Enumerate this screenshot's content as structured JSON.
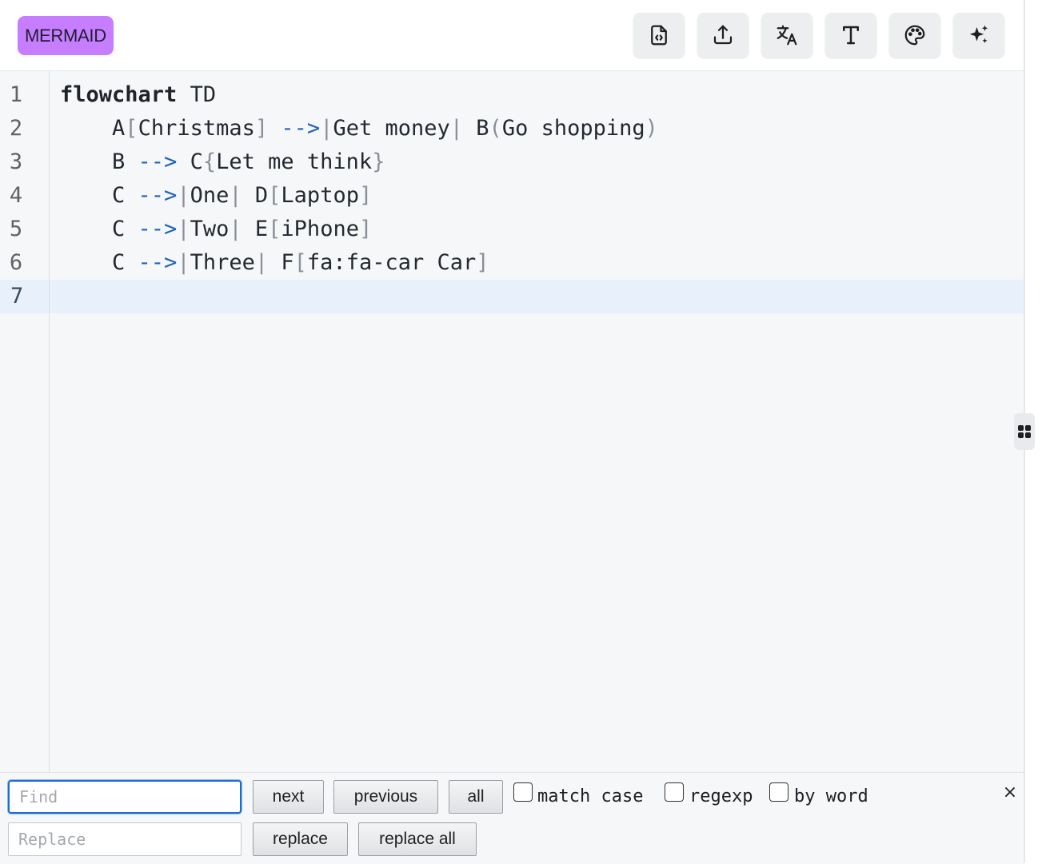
{
  "toolbar": {
    "badge": "MERMAID",
    "buttons": [
      {
        "name": "file-code-icon"
      },
      {
        "name": "share-upload-icon"
      },
      {
        "name": "translate-icon"
      },
      {
        "name": "font-type-icon"
      },
      {
        "name": "palette-icon"
      },
      {
        "name": "sparkles-icon"
      }
    ]
  },
  "editor": {
    "line_numbers": [
      "1",
      "2",
      "3",
      "4",
      "5",
      "6",
      "7"
    ],
    "active_line": 7,
    "lines": [
      {
        "indent": "",
        "tokens": [
          [
            "kw",
            "flowchart"
          ],
          [
            "t",
            " TD"
          ]
        ]
      },
      {
        "indent": "    ",
        "tokens": [
          [
            "t",
            "A"
          ],
          [
            "br",
            "["
          ],
          [
            "t",
            "Christmas"
          ],
          [
            "br",
            "]"
          ],
          [
            "t",
            " "
          ],
          [
            "arrow",
            "-->"
          ],
          [
            "br",
            "|"
          ],
          [
            "t",
            "Get money"
          ],
          [
            "br",
            "|"
          ],
          [
            "t",
            " B"
          ],
          [
            "br",
            "("
          ],
          [
            "t",
            "Go shopping"
          ],
          [
            "br",
            ")"
          ]
        ]
      },
      {
        "indent": "    ",
        "tokens": [
          [
            "t",
            "B "
          ],
          [
            "arrow",
            "-->"
          ],
          [
            "t",
            " C"
          ],
          [
            "br",
            "{"
          ],
          [
            "t",
            "Let me think"
          ],
          [
            "br",
            "}"
          ]
        ]
      },
      {
        "indent": "    ",
        "tokens": [
          [
            "t",
            "C "
          ],
          [
            "arrow",
            "-->"
          ],
          [
            "br",
            "|"
          ],
          [
            "t",
            "One"
          ],
          [
            "br",
            "|"
          ],
          [
            "t",
            " D"
          ],
          [
            "br",
            "["
          ],
          [
            "t",
            "Laptop"
          ],
          [
            "br",
            "]"
          ]
        ]
      },
      {
        "indent": "    ",
        "tokens": [
          [
            "t",
            "C "
          ],
          [
            "arrow",
            "-->"
          ],
          [
            "br",
            "|"
          ],
          [
            "t",
            "Two"
          ],
          [
            "br",
            "|"
          ],
          [
            "t",
            " E"
          ],
          [
            "br",
            "["
          ],
          [
            "t",
            "iPhone"
          ],
          [
            "br",
            "]"
          ]
        ]
      },
      {
        "indent": "    ",
        "tokens": [
          [
            "t",
            "C "
          ],
          [
            "arrow",
            "-->"
          ],
          [
            "br",
            "|"
          ],
          [
            "t",
            "Three"
          ],
          [
            "br",
            "|"
          ],
          [
            "t",
            " F"
          ],
          [
            "br",
            "["
          ],
          [
            "t",
            "fa:fa-car Car"
          ],
          [
            "br",
            "]"
          ]
        ]
      },
      {
        "indent": "",
        "tokens": []
      }
    ]
  },
  "find_panel": {
    "find_placeholder": "Find",
    "find_value": "",
    "replace_placeholder": "Replace",
    "replace_value": "",
    "next_label": "next",
    "previous_label": "previous",
    "all_label": "all",
    "match_case_label": "match case",
    "regexp_label": "regexp",
    "by_word_label": "by word",
    "replace_label": "replace",
    "replace_all_label": "replace all",
    "close_label": "×",
    "match_case_checked": false,
    "regexp_checked": false,
    "by_word_checked": false
  }
}
